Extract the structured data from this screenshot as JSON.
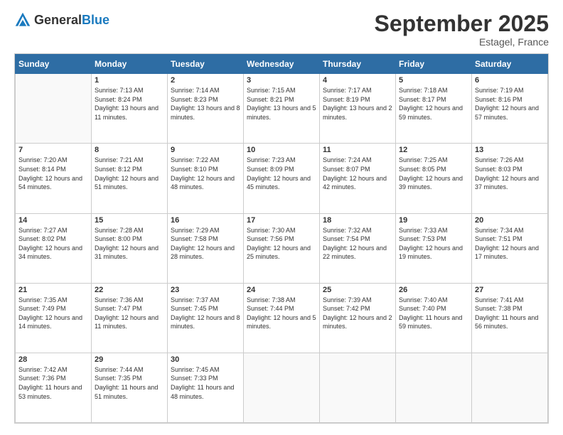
{
  "logo": {
    "general": "General",
    "blue": "Blue"
  },
  "header": {
    "month": "September 2025",
    "location": "Estagel, France"
  },
  "weekdays": [
    "Sunday",
    "Monday",
    "Tuesday",
    "Wednesday",
    "Thursday",
    "Friday",
    "Saturday"
  ],
  "weeks": [
    [
      {
        "day": "",
        "sunrise": "",
        "sunset": "",
        "daylight": ""
      },
      {
        "day": "1",
        "sunrise": "Sunrise: 7:13 AM",
        "sunset": "Sunset: 8:24 PM",
        "daylight": "Daylight: 13 hours and 11 minutes."
      },
      {
        "day": "2",
        "sunrise": "Sunrise: 7:14 AM",
        "sunset": "Sunset: 8:23 PM",
        "daylight": "Daylight: 13 hours and 8 minutes."
      },
      {
        "day": "3",
        "sunrise": "Sunrise: 7:15 AM",
        "sunset": "Sunset: 8:21 PM",
        "daylight": "Daylight: 13 hours and 5 minutes."
      },
      {
        "day": "4",
        "sunrise": "Sunrise: 7:17 AM",
        "sunset": "Sunset: 8:19 PM",
        "daylight": "Daylight: 13 hours and 2 minutes."
      },
      {
        "day": "5",
        "sunrise": "Sunrise: 7:18 AM",
        "sunset": "Sunset: 8:17 PM",
        "daylight": "Daylight: 12 hours and 59 minutes."
      },
      {
        "day": "6",
        "sunrise": "Sunrise: 7:19 AM",
        "sunset": "Sunset: 8:16 PM",
        "daylight": "Daylight: 12 hours and 57 minutes."
      }
    ],
    [
      {
        "day": "7",
        "sunrise": "Sunrise: 7:20 AM",
        "sunset": "Sunset: 8:14 PM",
        "daylight": "Daylight: 12 hours and 54 minutes."
      },
      {
        "day": "8",
        "sunrise": "Sunrise: 7:21 AM",
        "sunset": "Sunset: 8:12 PM",
        "daylight": "Daylight: 12 hours and 51 minutes."
      },
      {
        "day": "9",
        "sunrise": "Sunrise: 7:22 AM",
        "sunset": "Sunset: 8:10 PM",
        "daylight": "Daylight: 12 hours and 48 minutes."
      },
      {
        "day": "10",
        "sunrise": "Sunrise: 7:23 AM",
        "sunset": "Sunset: 8:09 PM",
        "daylight": "Daylight: 12 hours and 45 minutes."
      },
      {
        "day": "11",
        "sunrise": "Sunrise: 7:24 AM",
        "sunset": "Sunset: 8:07 PM",
        "daylight": "Daylight: 12 hours and 42 minutes."
      },
      {
        "day": "12",
        "sunrise": "Sunrise: 7:25 AM",
        "sunset": "Sunset: 8:05 PM",
        "daylight": "Daylight: 12 hours and 39 minutes."
      },
      {
        "day": "13",
        "sunrise": "Sunrise: 7:26 AM",
        "sunset": "Sunset: 8:03 PM",
        "daylight": "Daylight: 12 hours and 37 minutes."
      }
    ],
    [
      {
        "day": "14",
        "sunrise": "Sunrise: 7:27 AM",
        "sunset": "Sunset: 8:02 PM",
        "daylight": "Daylight: 12 hours and 34 minutes."
      },
      {
        "day": "15",
        "sunrise": "Sunrise: 7:28 AM",
        "sunset": "Sunset: 8:00 PM",
        "daylight": "Daylight: 12 hours and 31 minutes."
      },
      {
        "day": "16",
        "sunrise": "Sunrise: 7:29 AM",
        "sunset": "Sunset: 7:58 PM",
        "daylight": "Daylight: 12 hours and 28 minutes."
      },
      {
        "day": "17",
        "sunrise": "Sunrise: 7:30 AM",
        "sunset": "Sunset: 7:56 PM",
        "daylight": "Daylight: 12 hours and 25 minutes."
      },
      {
        "day": "18",
        "sunrise": "Sunrise: 7:32 AM",
        "sunset": "Sunset: 7:54 PM",
        "daylight": "Daylight: 12 hours and 22 minutes."
      },
      {
        "day": "19",
        "sunrise": "Sunrise: 7:33 AM",
        "sunset": "Sunset: 7:53 PM",
        "daylight": "Daylight: 12 hours and 19 minutes."
      },
      {
        "day": "20",
        "sunrise": "Sunrise: 7:34 AM",
        "sunset": "Sunset: 7:51 PM",
        "daylight": "Daylight: 12 hours and 17 minutes."
      }
    ],
    [
      {
        "day": "21",
        "sunrise": "Sunrise: 7:35 AM",
        "sunset": "Sunset: 7:49 PM",
        "daylight": "Daylight: 12 hours and 14 minutes."
      },
      {
        "day": "22",
        "sunrise": "Sunrise: 7:36 AM",
        "sunset": "Sunset: 7:47 PM",
        "daylight": "Daylight: 12 hours and 11 minutes."
      },
      {
        "day": "23",
        "sunrise": "Sunrise: 7:37 AM",
        "sunset": "Sunset: 7:45 PM",
        "daylight": "Daylight: 12 hours and 8 minutes."
      },
      {
        "day": "24",
        "sunrise": "Sunrise: 7:38 AM",
        "sunset": "Sunset: 7:44 PM",
        "daylight": "Daylight: 12 hours and 5 minutes."
      },
      {
        "day": "25",
        "sunrise": "Sunrise: 7:39 AM",
        "sunset": "Sunset: 7:42 PM",
        "daylight": "Daylight: 12 hours and 2 minutes."
      },
      {
        "day": "26",
        "sunrise": "Sunrise: 7:40 AM",
        "sunset": "Sunset: 7:40 PM",
        "daylight": "Daylight: 11 hours and 59 minutes."
      },
      {
        "day": "27",
        "sunrise": "Sunrise: 7:41 AM",
        "sunset": "Sunset: 7:38 PM",
        "daylight": "Daylight: 11 hours and 56 minutes."
      }
    ],
    [
      {
        "day": "28",
        "sunrise": "Sunrise: 7:42 AM",
        "sunset": "Sunset: 7:36 PM",
        "daylight": "Daylight: 11 hours and 53 minutes."
      },
      {
        "day": "29",
        "sunrise": "Sunrise: 7:44 AM",
        "sunset": "Sunset: 7:35 PM",
        "daylight": "Daylight: 11 hours and 51 minutes."
      },
      {
        "day": "30",
        "sunrise": "Sunrise: 7:45 AM",
        "sunset": "Sunset: 7:33 PM",
        "daylight": "Daylight: 11 hours and 48 minutes."
      },
      {
        "day": "",
        "sunrise": "",
        "sunset": "",
        "daylight": ""
      },
      {
        "day": "",
        "sunrise": "",
        "sunset": "",
        "daylight": ""
      },
      {
        "day": "",
        "sunrise": "",
        "sunset": "",
        "daylight": ""
      },
      {
        "day": "",
        "sunrise": "",
        "sunset": "",
        "daylight": ""
      }
    ]
  ]
}
